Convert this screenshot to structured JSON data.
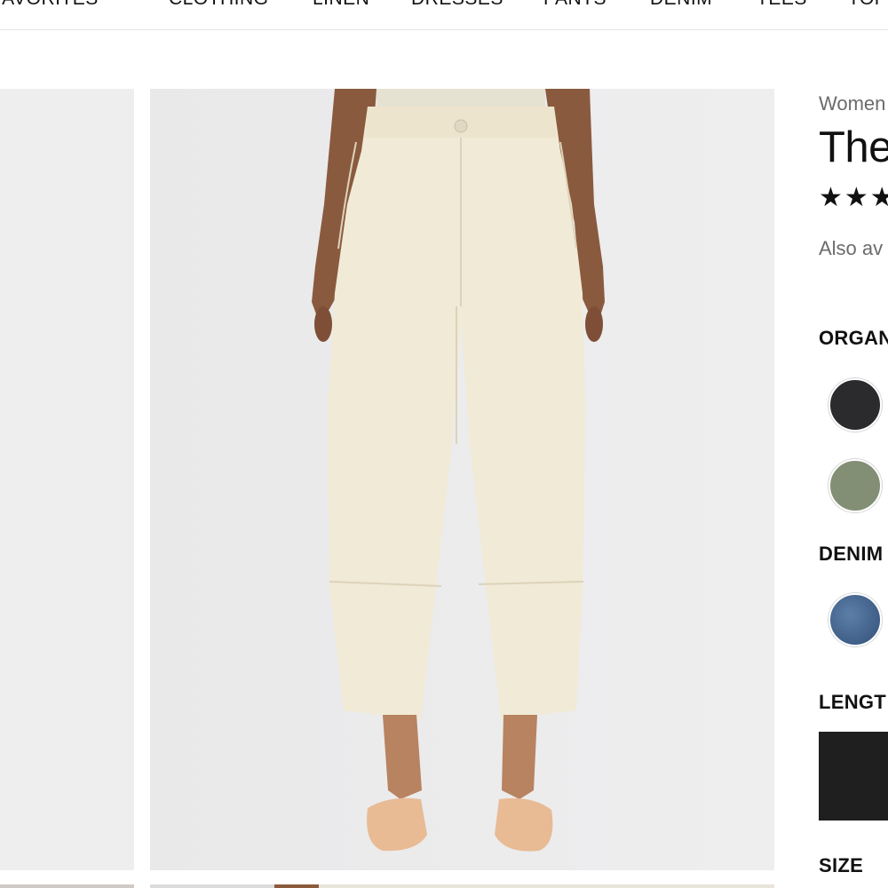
{
  "nav": {
    "items": [
      "FAVORITES",
      "CLOTHING",
      "LINEN",
      "DRESSES",
      "PANTS",
      "DENIM",
      "TEES",
      "TOPS"
    ]
  },
  "product": {
    "breadcrumb": "Women",
    "title": "The",
    "rating_stars": "★★★",
    "also_available": "Also av"
  },
  "sections": {
    "organic_label": "ORGAN",
    "denim_label": "DENIM",
    "length_label": "LENGT",
    "size_label": "SIZE"
  },
  "swatches": {
    "organic": [
      {
        "name": "black",
        "color": "#2b2b2d"
      },
      {
        "name": "olive",
        "color": "#838f74"
      }
    ],
    "denim": [
      {
        "name": "indigo",
        "color": "#3d5f8a"
      }
    ]
  },
  "colors": {
    "pants": "#f1ead6",
    "shoes": "#e8bb95",
    "length_selected": "#1f1f1f"
  }
}
